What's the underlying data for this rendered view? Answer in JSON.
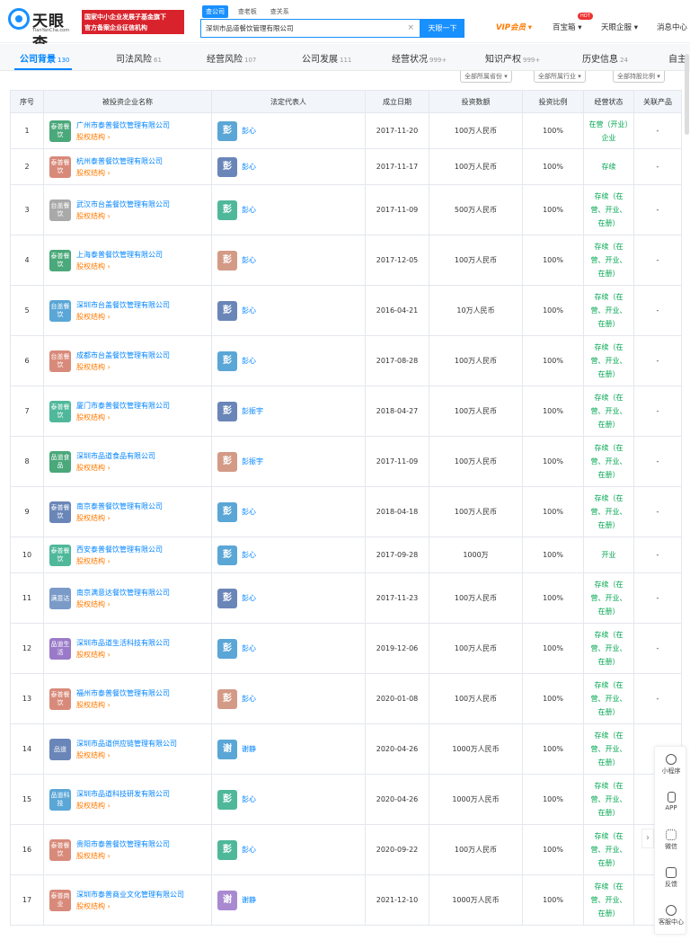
{
  "header": {
    "logo_zh": "天眼查",
    "logo_en": "TianYanCha.com",
    "banner_line1": "国家中小企业发展子基金旗下",
    "banner_line2": "官方备案企业征信机构",
    "search_tabs": [
      "查公司",
      "查老板",
      "查关系"
    ],
    "search_value": "深圳市品道餐饮管理有限公司",
    "search_button": "天眼一下",
    "vip": "VIP会员",
    "vip_caret": "▾",
    "baibao": "百宝箱",
    "hot": "HOT",
    "enterprise": "天眼企服",
    "messages": "消息中心"
  },
  "tabs": [
    {
      "label": "公司背景",
      "count": "130"
    },
    {
      "label": "司法风险",
      "count": "61"
    },
    {
      "label": "经营风险",
      "count": "107"
    },
    {
      "label": "公司发展",
      "count": "111"
    },
    {
      "label": "经营状况",
      "count": "999+"
    },
    {
      "label": "知识产权",
      "count": "999+"
    },
    {
      "label": "历史信息",
      "count": "24"
    },
    {
      "label": "自主",
      "count": ""
    }
  ],
  "filters": [
    "全部所属省份 ▾",
    "全部所属行业 ▾",
    "全部持股比例 ▾"
  ],
  "table": {
    "headers": [
      "序号",
      "被投资企业名称",
      "法定代表人",
      "成立日期",
      "投资数额",
      "投资比例",
      "经营状态",
      "关联产品"
    ],
    "equity_label": "股权结构 ›",
    "rows": [
      {
        "no": "1",
        "logo": "泰普餐饮",
        "logo_color": "#4aa87a",
        "name": "广州市泰普餐饮管理有限公司",
        "rep_char": "彭",
        "rep_color": "#5aa6d6",
        "rep": "彭心",
        "date": "2017-11-20",
        "amount": "100万人民币",
        "ratio": "100%",
        "status": "在营（开业）企业",
        "product": "-"
      },
      {
        "no": "2",
        "logo": "泰普餐饮",
        "logo_color": "#d88a7a",
        "name": "杭州泰普餐饮管理有限公司",
        "rep_char": "彭",
        "rep_color": "#6a86b8",
        "rep": "彭心",
        "date": "2017-11-17",
        "amount": "100万人民币",
        "ratio": "100%",
        "status": "存续",
        "product": "-"
      },
      {
        "no": "3",
        "logo": "台盖餐饮",
        "logo_color": "#a9a9a9",
        "name": "武汉市台盖餐饮管理有限公司",
        "rep_char": "彭",
        "rep_color": "#4fb89a",
        "rep": "彭心",
        "date": "2017-11-09",
        "amount": "500万人民币",
        "ratio": "100%",
        "status": "存续（在营、开业、在册）",
        "product": "-"
      },
      {
        "no": "4",
        "logo": "泰普餐饮",
        "logo_color": "#4aa87a",
        "name": "上海泰普餐饮管理有限公司",
        "rep_char": "彭",
        "rep_color": "#d39a86",
        "rep": "彭心",
        "date": "2017-12-05",
        "amount": "100万人民币",
        "ratio": "100%",
        "status": "存续（在营、开业、在册）",
        "product": "-"
      },
      {
        "no": "5",
        "logo": "台盖餐饮",
        "logo_color": "#5aa6d6",
        "name": "深圳市台盖餐饮管理有限公司",
        "rep_char": "彭",
        "rep_color": "#6a86b8",
        "rep": "彭心",
        "date": "2016-04-21",
        "amount": "10万人民币",
        "ratio": "100%",
        "status": "存续（在营、开业、在册）",
        "product": "-"
      },
      {
        "no": "6",
        "logo": "台盖餐饮",
        "logo_color": "#d88a7a",
        "name": "成都市台盖餐饮管理有限公司",
        "rep_char": "彭",
        "rep_color": "#5aa6d6",
        "rep": "彭心",
        "date": "2017-08-28",
        "amount": "100万人民币",
        "ratio": "100%",
        "status": "存续（在营、开业、在册）",
        "product": "-"
      },
      {
        "no": "7",
        "logo": "泰普餐饮",
        "logo_color": "#4fb89a",
        "name": "厦门市泰普餐饮管理有限公司",
        "rep_char": "彭",
        "rep_color": "#6a86b8",
        "rep": "彭振宇",
        "date": "2018-04-27",
        "amount": "100万人民币",
        "ratio": "100%",
        "status": "存续（在营、开业、在册）",
        "product": "-"
      },
      {
        "no": "8",
        "logo": "品道食品",
        "logo_color": "#4aa87a",
        "name": "深圳市品道食品有限公司",
        "rep_char": "彭",
        "rep_color": "#d39a86",
        "rep": "彭振宇",
        "date": "2017-11-09",
        "amount": "100万人民币",
        "ratio": "100%",
        "status": "存续（在营、开业、在册）",
        "product": "-"
      },
      {
        "no": "9",
        "logo": "泰普餐饮",
        "logo_color": "#6a86b8",
        "name": "南京泰普餐饮管理有限公司",
        "rep_char": "彭",
        "rep_color": "#5aa6d6",
        "rep": "彭心",
        "date": "2018-04-18",
        "amount": "100万人民币",
        "ratio": "100%",
        "status": "存续（在营、开业、在册）",
        "product": "-"
      },
      {
        "no": "10",
        "logo": "泰普餐饮",
        "logo_color": "#4fb89a",
        "name": "西安泰普餐饮管理有限公司",
        "rep_char": "彭",
        "rep_color": "#5aa6d6",
        "rep": "彭心",
        "date": "2017-09-28",
        "amount": "1000万",
        "ratio": "100%",
        "status": "开业",
        "product": "-"
      },
      {
        "no": "11",
        "logo": "满意达",
        "logo_color": "#7a9ac8",
        "name": "南京满意达餐饮管理有限公司",
        "rep_char": "彭",
        "rep_color": "#6a86b8",
        "rep": "彭心",
        "date": "2017-11-23",
        "amount": "100万人民币",
        "ratio": "100%",
        "status": "存续（在营、开业、在册）",
        "product": "-"
      },
      {
        "no": "12",
        "logo": "品道生活",
        "logo_color": "#9a7ac8",
        "name": "深圳市品道生活科技有限公司",
        "rep_char": "彭",
        "rep_color": "#5aa6d6",
        "rep": "彭心",
        "date": "2019-12-06",
        "amount": "100万人民币",
        "ratio": "100%",
        "status": "存续（在营、开业、在册）",
        "product": "-"
      },
      {
        "no": "13",
        "logo": "泰普餐饮",
        "logo_color": "#d88a7a",
        "name": "福州市泰普餐饮管理有限公司",
        "rep_char": "彭",
        "rep_color": "#d39a86",
        "rep": "彭心",
        "date": "2020-01-08",
        "amount": "100万人民币",
        "ratio": "100%",
        "status": "存续（在营、开业、在册）",
        "product": "-"
      },
      {
        "no": "14",
        "logo": "品道",
        "logo_color": "#6a86b8",
        "name": "深圳市品道供应链管理有限公司",
        "rep_char": "谢",
        "rep_color": "#5aa6d6",
        "rep": "谢静",
        "date": "2020-04-26",
        "amount": "1000万人民币",
        "ratio": "100%",
        "status": "存续（在营、开业、在册）",
        "product": "-"
      },
      {
        "no": "15",
        "logo": "品道科技",
        "logo_color": "#5aa6d6",
        "name": "深圳市品道科技研发有限公司",
        "rep_char": "彭",
        "rep_color": "#4fb89a",
        "rep": "彭心",
        "date": "2020-04-26",
        "amount": "1000万人民币",
        "ratio": "100%",
        "status": "存续（在营、开业、在册）",
        "product": "-"
      },
      {
        "no": "16",
        "logo": "泰普餐饮",
        "logo_color": "#d88a7a",
        "name": "贵阳市泰普餐饮管理有限公司",
        "rep_char": "彭",
        "rep_color": "#4fb89a",
        "rep": "彭心",
        "date": "2020-09-22",
        "amount": "100万人民币",
        "ratio": "100%",
        "status": "存续（在营、开业、在册）",
        "product": "-"
      },
      {
        "no": "17",
        "logo": "泰普商业",
        "logo_color": "#d88a7a",
        "name": "深圳市泰普商业文化管理有限公司",
        "rep_char": "谢",
        "rep_color": "#a98ad0",
        "rep": "谢静",
        "date": "2021-12-10",
        "amount": "1000万人民币",
        "ratio": "100%",
        "status": "存续（在营、开业、在册）",
        "product": "-"
      }
    ]
  },
  "side_panel": [
    {
      "label": "小程序",
      "icon": "mini-program-icon"
    },
    {
      "label": "APP",
      "icon": "phone-icon"
    },
    {
      "label": "微信",
      "icon": "qrcode-icon"
    },
    {
      "label": "反馈",
      "icon": "feedback-icon"
    },
    {
      "label": "客服中心",
      "icon": "customer-service-icon"
    }
  ],
  "side_arrow": "›"
}
